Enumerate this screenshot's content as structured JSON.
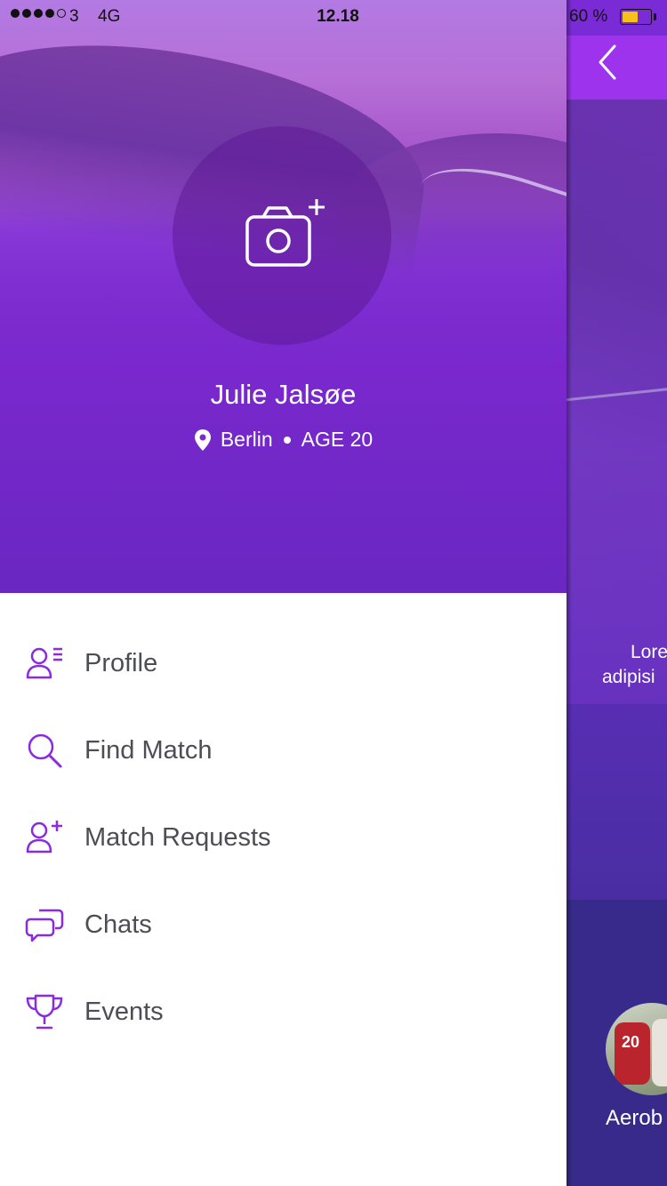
{
  "status_bar": {
    "carrier": "3",
    "network": "4G",
    "time": "12.18",
    "battery_text": "60 %",
    "battery_level": 0.6,
    "battery_color": "#f6c119"
  },
  "drawer": {
    "profile": {
      "name": "Julie Jalsøe",
      "city": "Berlin",
      "age": "AGE 20",
      "avatar_icon": "camera-add-icon"
    },
    "menu": [
      {
        "label": "Profile",
        "icon": "profile-icon"
      },
      {
        "label": "Find Match",
        "icon": "search-icon"
      },
      {
        "label": "Match Requests",
        "icon": "add-user-icon"
      },
      {
        "label": "Chats",
        "icon": "chat-icon"
      },
      {
        "label": "Events",
        "icon": "trophy-icon"
      }
    ],
    "accent_color": "#8a2be2"
  },
  "background_screen": {
    "text_line1": "Lore",
    "text_line2": "adipisi",
    "event_label": "Aerob",
    "avatar_number": "20",
    "back_icon": "chevron-left-icon"
  }
}
